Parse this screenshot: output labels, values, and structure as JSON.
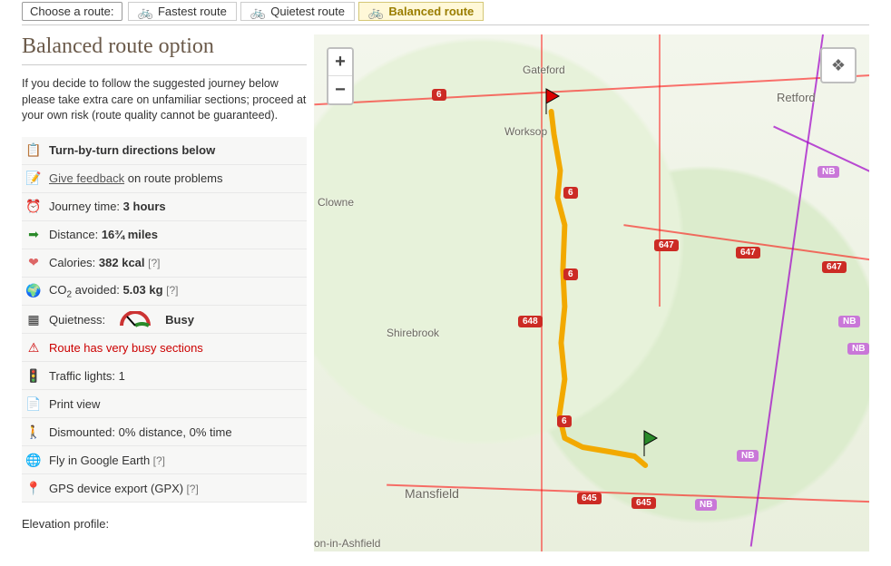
{
  "tabs": {
    "label": "Choose a route:",
    "fastest": "Fastest route",
    "quietest": "Quietest route",
    "balanced": "Balanced route",
    "active": "balanced"
  },
  "page_title": "Balanced route option",
  "intro": "If you decide to follow the suggested journey below please take extra care on unfamiliar sections; proceed at your own risk (route quality cannot be guaranteed).",
  "rows": {
    "turn_by_turn": "Turn-by-turn directions below",
    "feedback_link": "Give feedback",
    "feedback_suffix": " on route problems",
    "journey_time_label": "Journey time: ",
    "journey_time_value": "3 hours",
    "distance_label": "Distance: ",
    "distance_value": "16¾ miles",
    "calories_label": "Calories: ",
    "calories_value": "382 kcal",
    "co2_label_a": "CO",
    "co2_label_b": " avoided: ",
    "co2_value": "5.03 kg",
    "quietness_label": "Quietness:",
    "quietness_value": "Busy",
    "busy_warning": "Route has very busy sections",
    "traffic_lights_label": "Traffic lights: ",
    "traffic_lights_value": "1",
    "print_view": "Print view",
    "dismounted": "Dismounted: 0% distance, 0% time",
    "fly_earth": "Fly in Google Earth",
    "gpx": "GPS device export (GPX)",
    "help_q": " [?]"
  },
  "elevation_label": "Elevation profile:",
  "map": {
    "towns": {
      "gateford": "Gateford",
      "worksop": "Worksop",
      "retford": "Retford",
      "clowne": "Clowne",
      "shirebrook": "Shirebrook",
      "mansfield": "Mansfield",
      "ashfield": "on-in-Ashfield"
    },
    "shields": {
      "s6a": "6",
      "s6b": "6",
      "s6c": "6",
      "s6d": "6",
      "s647a": "647",
      "s647b": "647",
      "s647c": "647",
      "s648": "648",
      "s645a": "645",
      "s645b": "645",
      "nb": "NB"
    },
    "zoom_in": "+",
    "zoom_out": "−",
    "layers": "❖"
  }
}
